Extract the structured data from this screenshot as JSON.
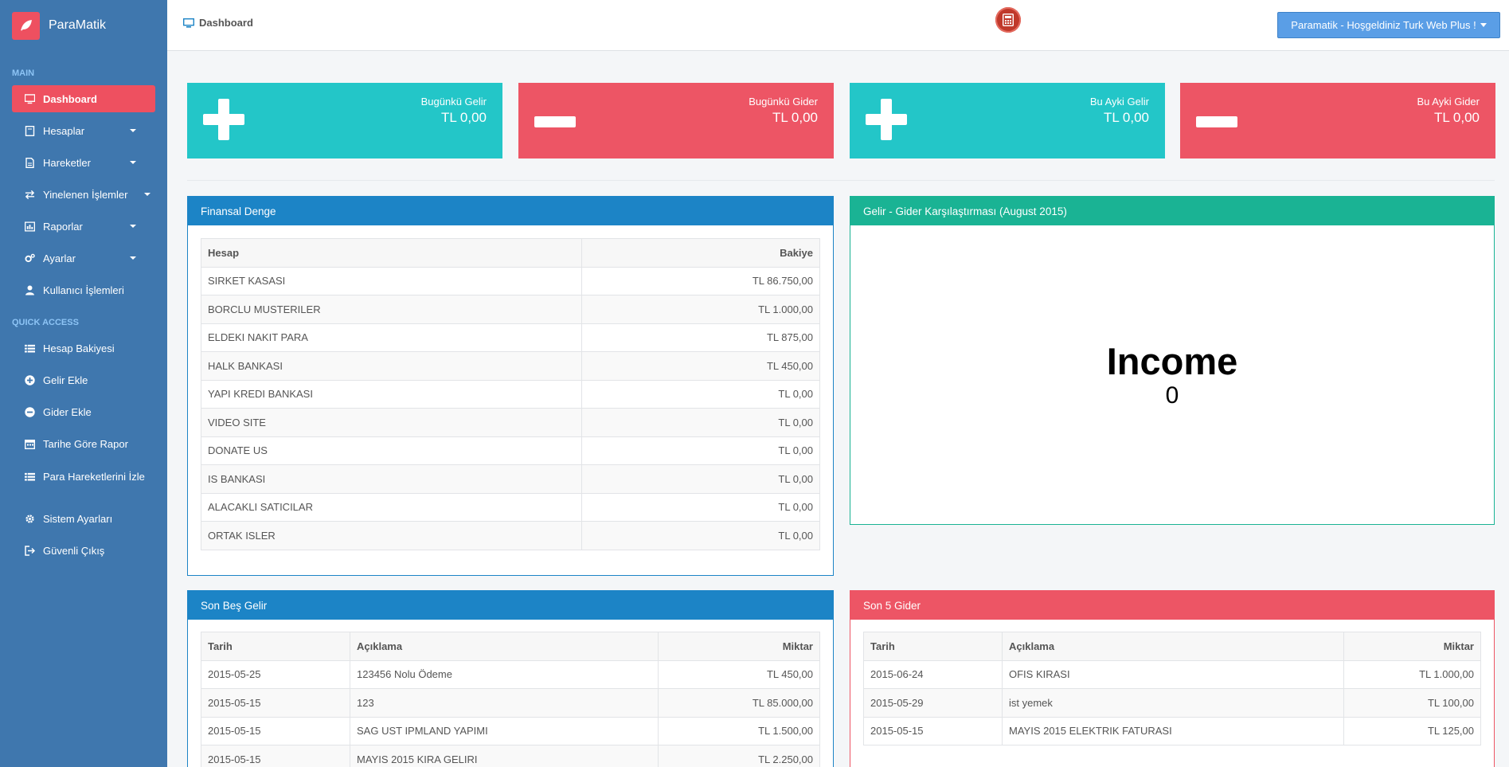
{
  "sidebar": {
    "brand": "ParaMatik",
    "main_title": "MAIN",
    "quick_title": "QUICK ACCESS",
    "main_items": [
      {
        "label": "Dashboard",
        "icon": "monitor-icon"
      },
      {
        "label": "Hesaplar",
        "icon": "book-icon"
      },
      {
        "label": "Hareketler",
        "icon": "document-icon"
      },
      {
        "label": "Yinelenen İşlemler",
        "icon": "exchange-icon"
      },
      {
        "label": "Raporlar",
        "icon": "chart-icon"
      },
      {
        "label": "Ayarlar",
        "icon": "gears-icon"
      },
      {
        "label": "Kullanıcı İşlemleri",
        "icon": "user-icon"
      }
    ],
    "quick_items": [
      {
        "label": "Hesap Bakiyesi",
        "icon": "list-icon"
      },
      {
        "label": "Gelir Ekle",
        "icon": "plus-circle-icon"
      },
      {
        "label": "Gider Ekle",
        "icon": "minus-circle-icon"
      },
      {
        "label": "Tarihe Göre Rapor",
        "icon": "calendar-icon"
      },
      {
        "label": "Para Hareketlerini İzle",
        "icon": "list-icon"
      },
      {
        "label": "Sistem Ayarları",
        "icon": "gear-icon"
      },
      {
        "label": "Güvenli Çıkış",
        "icon": "logout-icon"
      }
    ]
  },
  "header": {
    "breadcrumb": "Dashboard",
    "user_button": "Paramatik - Hoşgeldiniz Turk Web Plus !"
  },
  "stats": [
    {
      "title": "Bugünkü Gelir",
      "value": "TL 0,00",
      "color": "#23c6c8"
    },
    {
      "title": "Bugünkü Gider",
      "value": "TL 0,00",
      "color": "#ed5565"
    },
    {
      "title": "Bu Ayki Gelir",
      "value": "TL 0,00",
      "color": "#23c6c8"
    },
    {
      "title": "Bu Ayki Gider",
      "value": "TL 0,00",
      "color": "#ed5565"
    }
  ],
  "finance": {
    "title": "Finansal Denge",
    "columns": [
      "Hesap",
      "Bakiye"
    ],
    "rows": [
      [
        "SIRKET KASASI",
        "TL 86.750,00"
      ],
      [
        "BORCLU MUSTERILER",
        "TL 1.000,00"
      ],
      [
        "ELDEKI NAKIT PARA",
        "TL 875,00"
      ],
      [
        "HALK BANKASI",
        "TL 450,00"
      ],
      [
        "YAPI KREDI BANKASI",
        "TL 0,00"
      ],
      [
        "VIDEO SITE",
        "TL 0,00"
      ],
      [
        "DONATE US",
        "TL 0,00"
      ],
      [
        "IS BANKASI",
        "TL 0,00"
      ],
      [
        "ALACAKLI SATICILAR",
        "TL 0,00"
      ],
      [
        "ORTAK ISLER",
        "TL 0,00"
      ]
    ]
  },
  "comparison": {
    "title": "Gelir - Gider Karşılaştırması (August 2015)",
    "label": "Income",
    "value": "0"
  },
  "last_income": {
    "title": "Son Beş Gelir",
    "columns": [
      "Tarih",
      "Açıklama",
      "Miktar"
    ],
    "rows": [
      [
        "2015-05-25",
        "123456 Nolu Ödeme",
        "TL 450,00"
      ],
      [
        "2015-05-15",
        "123",
        "TL 85.000,00"
      ],
      [
        "2015-05-15",
        "SAG UST IPMLAND YAPIMI",
        "TL 1.500,00"
      ],
      [
        "2015-05-15",
        "MAYIS 2015 KIRA GELIRI",
        "TL 2.250,00"
      ]
    ]
  },
  "last_expense": {
    "title": "Son 5 Gider",
    "columns": [
      "Tarih",
      "Açıklama",
      "Miktar"
    ],
    "rows": [
      [
        "2015-06-24",
        "OFIS KIRASI",
        "TL 1.000,00"
      ],
      [
        "2015-05-29",
        "ist yemek",
        "TL 100,00"
      ],
      [
        "2015-05-15",
        "MAYIS 2015 ELEKTRIK FATURASI",
        "TL 125,00"
      ]
    ]
  }
}
